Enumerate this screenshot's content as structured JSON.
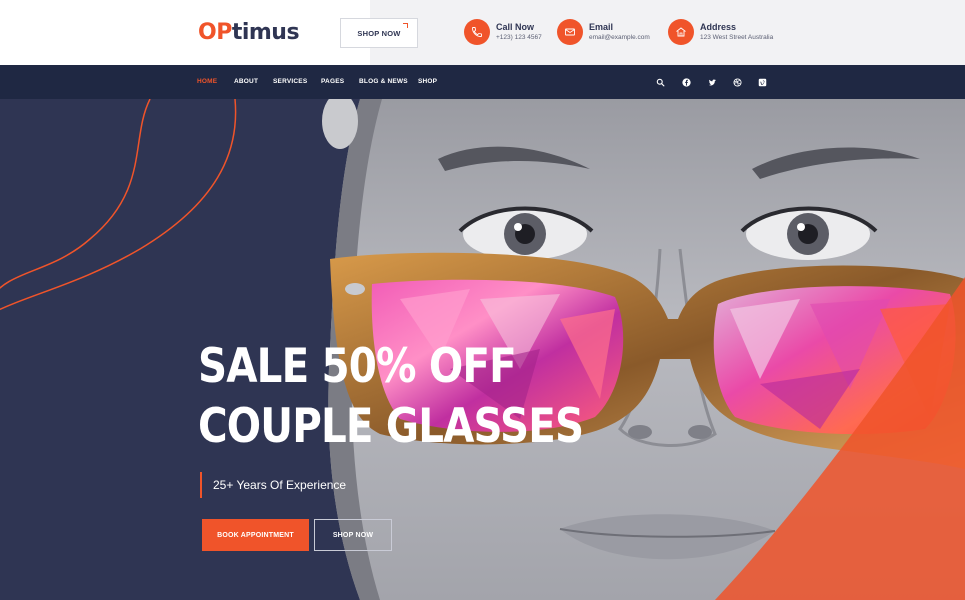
{
  "header": {
    "logo_accent": "OP",
    "logo_rest": "timus",
    "shop_now_label": "SHOP NOW",
    "contacts": [
      {
        "label": "Call Now",
        "value": "+123) 123 4567",
        "icon": "phone-icon"
      },
      {
        "label": "Email",
        "value": "email@example.com",
        "icon": "mail-icon"
      },
      {
        "label": "Address",
        "value": "123 West Street Australia",
        "icon": "home-icon"
      }
    ]
  },
  "nav": {
    "items": [
      "HOME",
      "ABOUT",
      "SERVICES",
      "PAGES",
      "BLOG & NEWS",
      "SHOP"
    ],
    "active": "HOME",
    "social_icons": [
      "search-icon",
      "facebook-icon",
      "twitter-icon",
      "dribbble-icon",
      "vimeo-icon"
    ]
  },
  "hero": {
    "title_line1": "SALE 50% OFF",
    "title_line2": "COUPLE GLASSES",
    "subtitle": "25+ Years Of Experience",
    "book_label": "BOOK APPOINTMENT",
    "shop_label": "SHOP NOW"
  },
  "colors": {
    "accent": "#f0542a",
    "dark_navy": "#1f2843",
    "hero_bg": "#2f3553",
    "lens_pink": "#e2449a"
  }
}
